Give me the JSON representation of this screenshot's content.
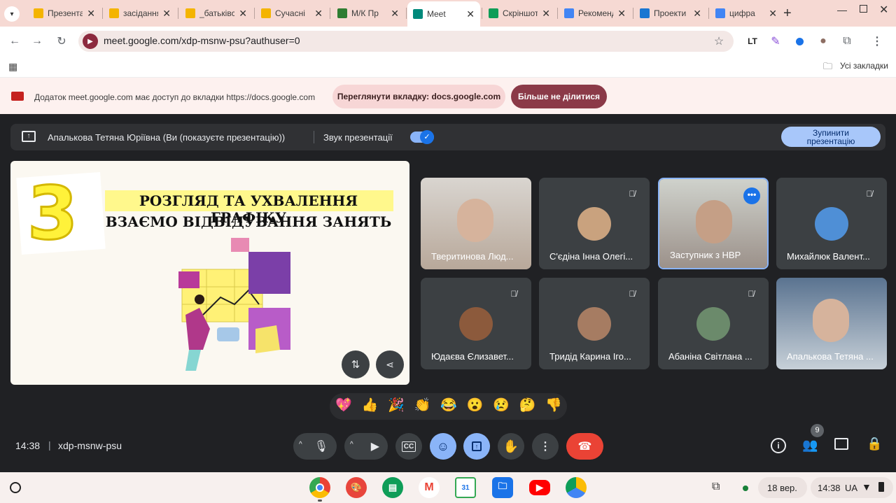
{
  "tabs": [
    {
      "title": "Презентаці",
      "color": "#f4b400"
    },
    {
      "title": "засідання",
      "color": "#f4b400"
    },
    {
      "title": "_батьківсь",
      "color": "#f4b400"
    },
    {
      "title": "Сучасні",
      "color": "#f4b400"
    },
    {
      "title": "М/К Пр",
      "color": "#2e7d32"
    },
    {
      "title": "Meet",
      "color": "#00897b"
    },
    {
      "title": "Скріншот",
      "color": "#0f9d58"
    },
    {
      "title": "Рекоменд",
      "color": "#4285f4"
    },
    {
      "title": "Проекти",
      "color": "#1976d2"
    },
    {
      "title": "цифра",
      "color": "#4285f4"
    }
  ],
  "browser": {
    "url": "meet.google.com/xdp-msnw-psu?authuser=0",
    "bookmarks_label": "Усі закладки"
  },
  "infobar": {
    "message": "Додаток meet.google.com має доступ до вкладки https://docs.google.com",
    "view_tab": "Переглянути вкладку: docs.google.com",
    "stop_sharing": "Більше не ділитися"
  },
  "presenting": {
    "presenter": "Апалькова Тетяна Юріївна (Ви (показуєте презентацію))",
    "audio_label": "Звук презентації",
    "stop_line1": "Зупинити",
    "stop_line2": "презентацію"
  },
  "slide": {
    "number": "3",
    "line1": "РОЗГЛЯД ТА УХВАЛЕННЯ ГРАФІКУ",
    "line2": "ВЗАЄМО ВІДВІДУВАННЯ ЗАНЯТЬ"
  },
  "participants": [
    {
      "name": "Тверитинова Люд...",
      "muted": false,
      "video": true
    },
    {
      "name": "С'єдіна Інна Олегі...",
      "muted": true,
      "video": false,
      "avatar": "#c9a27e"
    },
    {
      "name": "Заступник з НВР",
      "muted": false,
      "video": true,
      "active": true
    },
    {
      "name": "Михайлюк Валент...",
      "muted": true,
      "video": false,
      "avatar": "#4f8fd6"
    },
    {
      "name": "Юдаєва Єлизавет...",
      "muted": true,
      "video": false,
      "avatar": "#8c5a3c"
    },
    {
      "name": "Тридід Карина Іго...",
      "muted": true,
      "video": false,
      "avatar": "#a67c62"
    },
    {
      "name": "Абаніна Світлана ...",
      "muted": true,
      "video": false,
      "avatar": "#6b8a6b"
    },
    {
      "name": "Апалькова Тетяна ...",
      "muted": false,
      "video": true
    }
  ],
  "reactions": [
    "💖",
    "👍",
    "🎉",
    "👏",
    "😂",
    "😮",
    "😢",
    "🤔",
    "👎"
  ],
  "meeting": {
    "time": "14:38",
    "code": "xdp-msnw-psu",
    "participant_count": "9"
  },
  "shelf": {
    "date": "18 вер.",
    "time": "14:38",
    "lang": "UA"
  }
}
